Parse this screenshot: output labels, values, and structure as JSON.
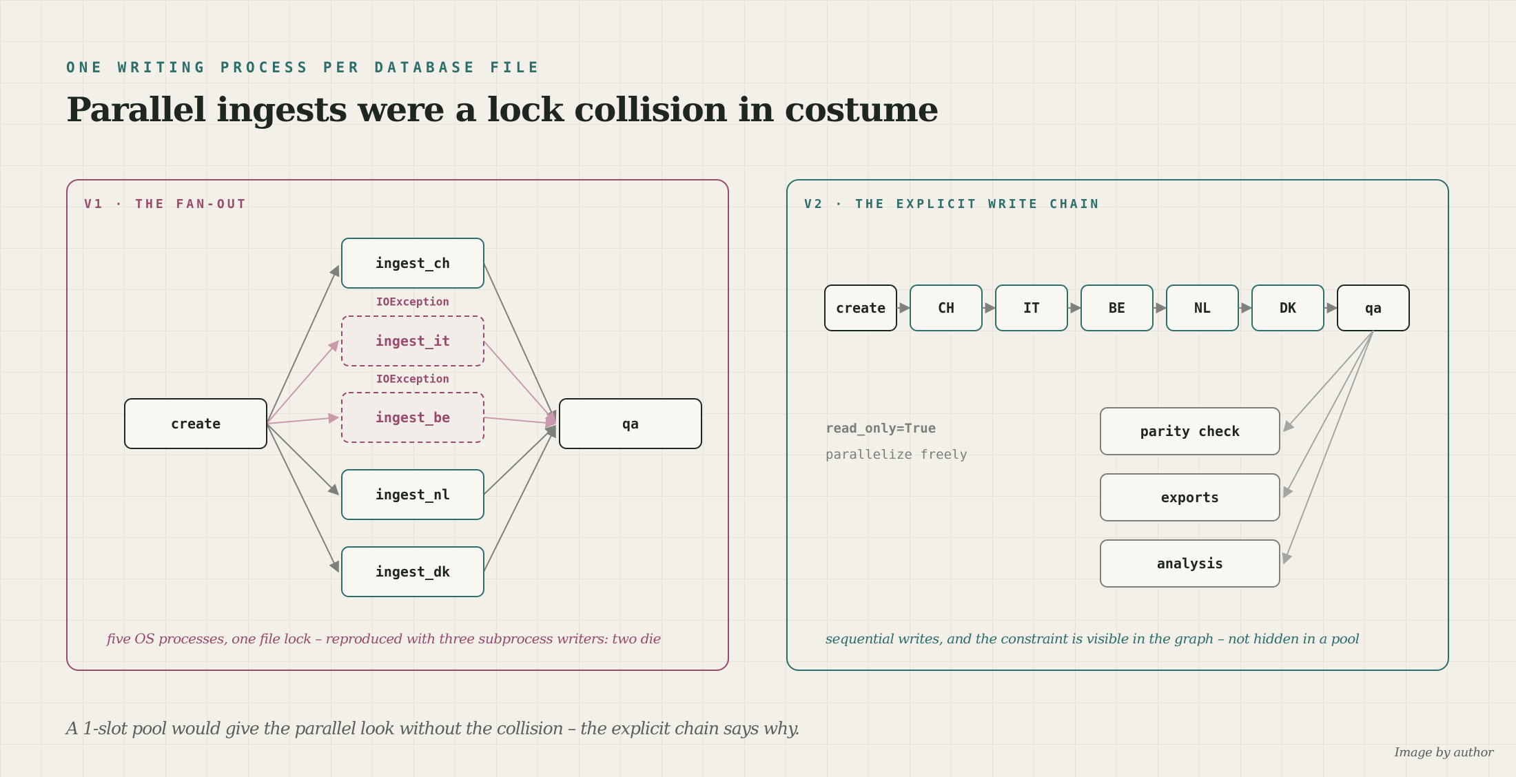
{
  "header": {
    "eyebrow": "ONE WRITING PROCESS PER DATABASE FILE",
    "title": "Parallel ingests were a lock collision in costume"
  },
  "v1": {
    "label": "V1 · THE FAN-OUT",
    "nodes": {
      "create": "create",
      "ingest_ch": "ingest_ch",
      "ingest_it": "ingest_it",
      "ingest_be": "ingest_be",
      "ingest_nl": "ingest_nl",
      "ingest_dk": "ingest_dk",
      "qa": "qa"
    },
    "errors": {
      "ingest_it": "IOException",
      "ingest_be": "IOException"
    },
    "caption": "five OS processes, one file lock – reproduced with three subprocess writers: two die"
  },
  "v2": {
    "label": "V2 · THE EXPLICIT WRITE CHAIN",
    "chain": [
      "create",
      "CH",
      "IT",
      "BE",
      "NL",
      "DK",
      "qa"
    ],
    "readers": [
      "parity check",
      "exports",
      "analysis"
    ],
    "note_code": "read_only=True",
    "note_text": "parallelize freely",
    "caption": "sequential writes, and the constraint is visible in the graph – not hidden in a pool"
  },
  "footer": "A 1-slot pool would give the parallel look without the collision – the explicit chain says why.",
  "credit": "Image by author",
  "colors": {
    "background": "#f3f0ea",
    "teal": "#2c6e6a",
    "rose": "#9a4a6c",
    "ink": "#1e2622",
    "arrow_gray": "#7e807c",
    "arrow_rose": "#c99aab",
    "arrow_light": "#a3a6a1"
  }
}
